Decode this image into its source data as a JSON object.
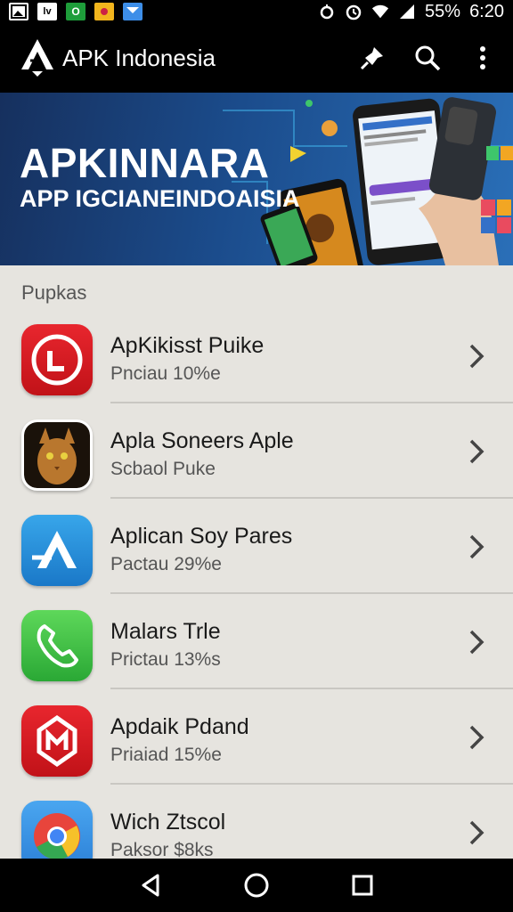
{
  "status_bar": {
    "battery": "55%",
    "time": "6:20",
    "notification_icons": [
      "image-icon",
      "lv-icon",
      "o-icon",
      "sun-icon",
      "message-icon"
    ]
  },
  "app_bar": {
    "title": "APK Indonesia",
    "actions": [
      "pin-icon",
      "search-icon",
      "more-vert-icon"
    ]
  },
  "banner": {
    "title": "APKINNARA",
    "subtitle": "APP IGCIANEINDOAISIA"
  },
  "section": {
    "label": "Pupkas"
  },
  "apps": [
    {
      "name": "ApKikisst Puike",
      "subtitle": "Pnciau 10%e",
      "icon": "red-l-icon"
    },
    {
      "name": "Apla Soneers Aple",
      "subtitle": "Scbaol Puke",
      "icon": "cat-icon"
    },
    {
      "name": "Aplican Soy Pares",
      "subtitle": "Pactau 29%e",
      "icon": "blue-a-icon"
    },
    {
      "name": "Malars Trle",
      "subtitle": "Prictau 13%s",
      "icon": "phone-icon"
    },
    {
      "name": "Apdaik Pdand",
      "subtitle": "Priaiad 15%e",
      "icon": "red-m-icon"
    },
    {
      "name": "Wich Ztscol",
      "subtitle": "Paksor $8ks",
      "icon": "chrome-icon"
    }
  ],
  "colors": {
    "toolbar_bg": "#000000",
    "list_bg": "#e6e4df",
    "banner_bg": "#1b4c8c"
  }
}
